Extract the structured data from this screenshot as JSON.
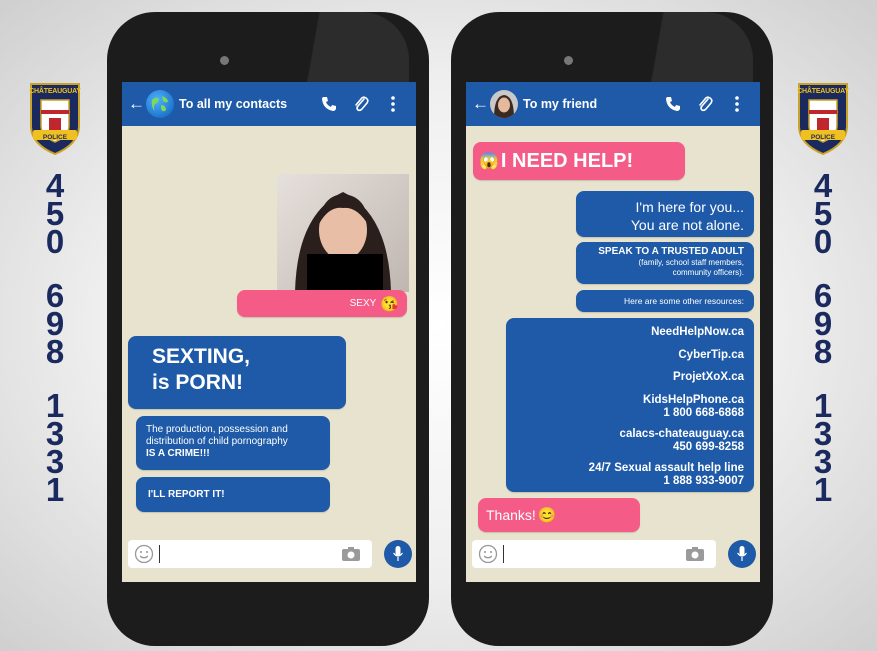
{
  "badge": {
    "top_text": "CHÂTEAUGUAY",
    "bottom_text": "POLICE"
  },
  "phone_number_digits": [
    "4",
    "5",
    "0",
    "6",
    "9",
    "8",
    "1",
    "3",
    "3",
    "1"
  ],
  "phone1": {
    "contact": "To all my contacts",
    "caption_text": "SEXY",
    "caption_emoji": "😘",
    "message1_line1": "SEXTING,",
    "message1_line2": "is PORN!",
    "message2_text": "The production, possession and distribution of child pornography",
    "message2_bold": "IS A CRIME!!!",
    "message3": "I'LL REPORT IT!"
  },
  "phone2": {
    "contact": "To my friend",
    "help_emoji": "😱",
    "help_text": "I NEED HELP!",
    "reply1_line1": "I'm here for you...",
    "reply1_line2": "You are not alone.",
    "adult_title": "SPEAK TO A TRUSTED ADULT",
    "adult_line1": "(family, school staff members,",
    "adult_line2": "community officers).",
    "resources_intro": "Here are some other resources:",
    "resources": [
      {
        "name": "NeedHelpNow.ca",
        "phone": ""
      },
      {
        "name": "CyberTip.ca",
        "phone": ""
      },
      {
        "name": "ProjetXoX.ca",
        "phone": ""
      },
      {
        "name": "KidsHelpPhone.ca",
        "phone": "1 800 668-6868"
      },
      {
        "name": "calacs-chateauguay.ca",
        "phone": "450 699-8258"
      },
      {
        "name": "24/7 Sexual assault help line",
        "phone": "1 888 933-9007"
      }
    ],
    "thanks_text": "Thanks!",
    "thanks_emoji": "😊"
  },
  "colors": {
    "header_blue": "#1e5aa8",
    "bubble_pink": "#f45b87",
    "navy_digits": "#1a2a5e",
    "chat_bg": "#e8e3cf"
  },
  "icons": [
    "back-arrow-icon",
    "globe-icon",
    "phone-icon",
    "paperclip-icon",
    "more-icon",
    "smiley-icon",
    "camera-icon",
    "microphone-icon"
  ]
}
